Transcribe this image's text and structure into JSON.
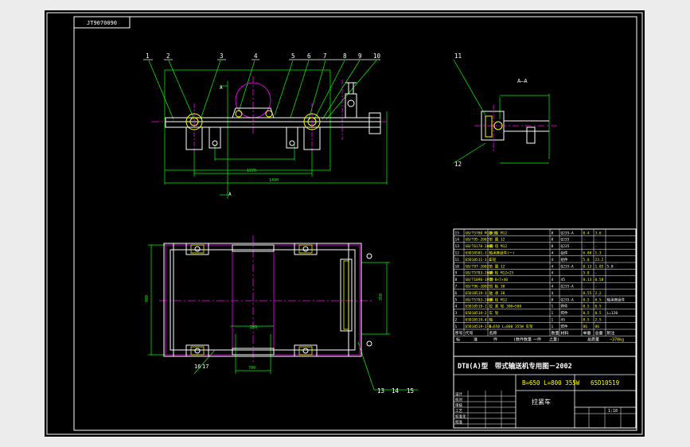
{
  "drawing": {
    "code_box": "JT9070090",
    "part_balloons_top": [
      "1",
      "2",
      "3",
      "4",
      "5",
      "6",
      "7",
      "8",
      "9",
      "10"
    ],
    "part_balloons_side": [
      "11",
      "12"
    ],
    "part_balloons_bottom": [
      "13",
      "14",
      "15"
    ],
    "section_label": "A—A",
    "section_mark_top": "A",
    "section_mark_bottom": "A",
    "balloon_16": "16",
    "balloon_17": "17",
    "dimensions": {
      "top_span": "1490",
      "top_middle": "1070",
      "side_depth": "870",
      "plan_height": "900",
      "plan_right": "350",
      "plan_bottom": "700",
      "plan_side_small": "200"
    }
  },
  "title_block": {
    "main_title": "DTⅡ(A)型　带式输送机专用图－2002",
    "spec": "B=650 L=800 355W",
    "drawing_no": "65D10519",
    "name": "拉紧车",
    "mass_label": "总质量",
    "mass_value": "~370kg",
    "scale": "1:10",
    "header_row": [
      "序号",
      "代号",
      "名称",
      "数量",
      "材料",
      "单重",
      "总重",
      "附注"
    ],
    "standard_row": [
      "标",
      "准",
      "件",
      "(数件数量",
      "一件",
      "之量)"
    ],
    "sign_rows": [
      "设计",
      "校对",
      "审核",
      "工艺",
      "标准化",
      "批准"
    ]
  },
  "bom": [
    {
      "no": "15",
      "code": "GB/T5780 M12×35",
      "name": "螺 栓 M12",
      "qty": "8",
      "mat": "Q235-A",
      "unit": "0.4",
      "total": "3.6",
      "note": ""
    },
    {
      "no": "14",
      "code": "GB/T95-2002",
      "name": "垫 圈 12",
      "qty": "8",
      "mat": "Q235",
      "unit": "-",
      "total": "-",
      "note": ""
    },
    {
      "no": "13",
      "code": "GB/T6170-2000",
      "name": "螺 母 M12",
      "qty": "8",
      "mat": "Q235",
      "unit": "-",
      "total": "-",
      "note": ""
    },
    {
      "no": "12",
      "code": "65D10501-1",
      "name": "轴承座组件(一)",
      "qty": "4",
      "mat": "组件",
      "unit": "6.88",
      "total": "1.3",
      "note": ""
    },
    {
      "no": "11",
      "code": "65D10511-1-1",
      "name": "车轮",
      "qty": "4",
      "mat": "组件",
      "unit": "5.8",
      "total": "23.2",
      "note": ""
    },
    {
      "no": "10",
      "code": "GB/T97-2002",
      "name": "垫 圈 12",
      "qty": "4",
      "mat": "Q235-A",
      "unit": "0.13",
      "total": "1.05",
      "note": "5.8"
    },
    {
      "no": "9",
      "code": "GB/T5783-2000",
      "name": "螺 栓 M12×25",
      "qty": "4",
      "mat": "",
      "unit": "5.8",
      "total": "-",
      "note": ""
    },
    {
      "no": "8",
      "code": "GB/T1096-1979",
      "name": "键 8×7×40",
      "qty": "4",
      "mat": "45",
      "unit": "0.13",
      "total": "0.58",
      "note": ""
    },
    {
      "no": "7",
      "code": "GB/T96-2002",
      "name": "挡 板 30",
      "qty": "4",
      "mat": "Q235-A",
      "unit": "-",
      "total": "-",
      "note": ""
    },
    {
      "no": "6",
      "code": "65D10519-3",
      "name": "轴 承 30",
      "qty": "4",
      "mat": "",
      "unit": "0.55",
      "total": "2.2",
      "note": ""
    },
    {
      "no": "5",
      "code": "GB/T5783-2000",
      "name": "螺 栓 M12",
      "qty": "8",
      "mat": "Q235-A",
      "unit": "0.5",
      "total": "0.5",
      "note": "轴承座组件"
    },
    {
      "no": "4",
      "code": "65D10519-1",
      "name": "拉 紧 轮 300×500",
      "qty": "1",
      "mat": "焊件",
      "unit": "0.5",
      "total": "0.5",
      "note": ""
    },
    {
      "no": "3",
      "code": "65D10519-2",
      "name": "车 架",
      "qty": "1",
      "mat": "焊件",
      "unit": "0.5",
      "total": "0.5",
      "note": "L=120"
    },
    {
      "no": "2",
      "code": "65D10519-4",
      "name": "轴",
      "qty": "1",
      "mat": "45",
      "unit": "0.5",
      "total": "2.5",
      "note": ""
    },
    {
      "no": "1",
      "code": "65D10519-1-1",
      "name": "B=650 L=800 355W 车架",
      "qty": "1",
      "mat": "焊件",
      "unit": "86",
      "total": "86",
      "note": ""
    }
  ],
  "colors": {
    "background": "#000000",
    "frame": "#ffffff",
    "outline": "#ffffff",
    "construction": "#00ff00",
    "magenta": "#ff00ff",
    "yellow": "#ffff00",
    "cyan": "#00ffff"
  }
}
